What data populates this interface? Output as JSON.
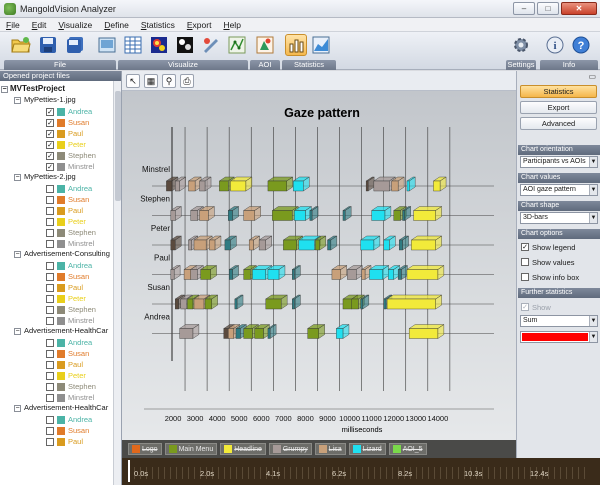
{
  "window": {
    "title": "MangoldVision Analyzer",
    "minimize": "–",
    "maximize": "□",
    "close": "✕"
  },
  "menu": [
    "File",
    "Edit",
    "Visualize",
    "Define",
    "Statistics",
    "Export",
    "Help"
  ],
  "toolbar": {
    "groups": [
      {
        "caption": "File",
        "icons": [
          "open-folder-icon",
          "save-icon",
          "save-all-icon",
          "screenshot-icon"
        ]
      },
      {
        "caption": "Visualize",
        "icons": [
          "table-icon",
          "heatmap-icon",
          "spotlight-icon",
          "gaze-replay-icon",
          "scanpath-icon"
        ]
      },
      {
        "caption": "AOI",
        "icons": [
          "aoi-icon"
        ]
      },
      {
        "caption": "Statistics",
        "icons": [
          "statistics-bars-icon",
          "statistics-area-icon"
        ]
      },
      {
        "caption": "Settings",
        "icons": [
          "settings-icon"
        ]
      },
      {
        "caption": "Info",
        "icons": [
          "info-icon",
          "help-icon"
        ]
      }
    ]
  },
  "left_panel": {
    "header": "Opened project files",
    "root": "MVTestProject",
    "files": [
      {
        "name": "MyPetties-1.jpg",
        "participants": [
          {
            "name": "Andrea",
            "checked": true
          },
          {
            "name": "Susan",
            "checked": true
          },
          {
            "name": "Paul",
            "checked": true
          },
          {
            "name": "Peter",
            "checked": true
          },
          {
            "name": "Stephen",
            "checked": true
          },
          {
            "name": "Minstrel",
            "checked": true
          }
        ]
      },
      {
        "name": "MyPetties-2.jpg",
        "participants": [
          {
            "name": "Andrea",
            "checked": false
          },
          {
            "name": "Susan",
            "checked": false
          },
          {
            "name": "Paul",
            "checked": false
          },
          {
            "name": "Peter",
            "checked": false
          },
          {
            "name": "Stephen",
            "checked": false
          },
          {
            "name": "Minstrel",
            "checked": false
          }
        ]
      },
      {
        "name": "Advertisement-Consulting",
        "participants": [
          {
            "name": "Andrea",
            "checked": false
          },
          {
            "name": "Susan",
            "checked": false
          },
          {
            "name": "Paul",
            "checked": false
          },
          {
            "name": "Peter",
            "checked": false
          },
          {
            "name": "Stephen",
            "checked": false
          },
          {
            "name": "Minstrel",
            "checked": false
          }
        ]
      },
      {
        "name": "Advertisement-HealthCar",
        "participants": [
          {
            "name": "Andrea",
            "checked": false
          },
          {
            "name": "Susan",
            "checked": false
          },
          {
            "name": "Paul",
            "checked": false
          },
          {
            "name": "Peter",
            "checked": false
          },
          {
            "name": "Stephen",
            "checked": false
          },
          {
            "name": "Minstrel",
            "checked": false
          }
        ]
      },
      {
        "name": "Advertisement-HealthCar",
        "participants": [
          {
            "name": "Andrea",
            "checked": false
          },
          {
            "name": "Susan",
            "checked": false
          },
          {
            "name": "Paul",
            "checked": false
          }
        ]
      }
    ],
    "participant_colors": {
      "Andrea": "#4bb3a6",
      "Susan": "#e07b2a",
      "Paul": "#d99b1e",
      "Peter": "#e9cf1a",
      "Stephen": "#8d8a78",
      "Minstrel": "#8f8f8f"
    }
  },
  "chart_toolbar": {
    "icons": [
      "pointer-icon",
      "copy-chart-icon",
      "zoom-icon",
      "print-icon"
    ]
  },
  "chart_data": {
    "type": "bar",
    "subtype": "3D gantt / gaze timeline",
    "title": "Gaze pattern",
    "xlabel": "milliseconds",
    "xlim": [
      1500,
      16000
    ],
    "xticks": [
      2000,
      3000,
      4000,
      5000,
      6000,
      7000,
      8000,
      9000,
      10000,
      11000,
      12000,
      13000,
      14000
    ],
    "categories": [
      "Minstrel",
      "Stephen",
      "Peter",
      "Paul",
      "Susan",
      "Andrea"
    ],
    "aoi_colors": {
      "Logo": "#5a4a3e",
      "Main Menu": "#7a9a1e",
      "Headline": "#f2ea3a",
      "Grumpy": "#a69a98",
      "Lisa": "#c8a07a",
      "Lizard": "#1fe0f0",
      "AOI_5": "#2f7b82"
    },
    "series": [
      {
        "name": "Minstrel",
        "segments": [
          [
            1700,
            1950,
            "Logo"
          ],
          [
            2100,
            2300,
            "Grumpy"
          ],
          [
            2700,
            3000,
            "Lisa"
          ],
          [
            3200,
            3450,
            "Grumpy"
          ],
          [
            4100,
            4500,
            "Main Menu"
          ],
          [
            4600,
            5300,
            "Headline"
          ],
          [
            6300,
            7150,
            "Main Menu"
          ],
          [
            7450,
            7900,
            "Lizard"
          ],
          [
            10750,
            10800,
            "Logo"
          ],
          [
            11100,
            11800,
            "Grumpy"
          ],
          [
            11900,
            12200,
            "Lisa"
          ],
          [
            12600,
            12700,
            "Lizard"
          ],
          [
            13800,
            14100,
            "Headline"
          ]
        ]
      },
      {
        "name": "Stephen",
        "segments": [
          [
            1900,
            2100,
            "Grumpy"
          ],
          [
            2800,
            3100,
            "Grumpy"
          ],
          [
            3200,
            3600,
            "Lisa"
          ],
          [
            4500,
            4700,
            "AOI_5"
          ],
          [
            5200,
            5700,
            "Lisa"
          ],
          [
            6500,
            7400,
            "Main Menu"
          ],
          [
            7500,
            8000,
            "Lizard"
          ],
          [
            8200,
            8300,
            "AOI_5"
          ],
          [
            9700,
            9800,
            "AOI_5"
          ],
          [
            11000,
            11600,
            "Lizard"
          ],
          [
            12000,
            12300,
            "Main Menu"
          ],
          [
            12400,
            12500,
            "AOI_5"
          ],
          [
            12900,
            13900,
            "Headline"
          ]
        ]
      },
      {
        "name": "Peter",
        "segments": [
          [
            1900,
            2100,
            "Logo"
          ],
          [
            2700,
            2850,
            "Grumpy"
          ],
          [
            2950,
            3500,
            "Lisa"
          ],
          [
            3650,
            3900,
            "Lisa"
          ],
          [
            4350,
            4600,
            "AOI_5"
          ],
          [
            5450,
            5650,
            "Lisa"
          ],
          [
            5900,
            6200,
            "Grumpy"
          ],
          [
            7000,
            7600,
            "Main Menu"
          ],
          [
            7700,
            8400,
            "Lizard"
          ],
          [
            8450,
            8650,
            "Main Menu"
          ],
          [
            9000,
            9150,
            "AOI_5"
          ],
          [
            10500,
            11100,
            "Lizard"
          ],
          [
            11550,
            11800,
            "Lizard"
          ],
          [
            12250,
            12400,
            "AOI_5"
          ],
          [
            12800,
            13900,
            "Headline"
          ]
        ]
      },
      {
        "name": "Paul",
        "segments": [
          [
            1900,
            2050,
            "Grumpy"
          ],
          [
            2500,
            2800,
            "Lisa"
          ],
          [
            2800,
            3100,
            "Grumpy"
          ],
          [
            3250,
            3700,
            "Main Menu"
          ],
          [
            4550,
            4700,
            "AOI_5"
          ],
          [
            5200,
            5500,
            "Main Menu"
          ],
          [
            5600,
            6200,
            "Lizard"
          ],
          [
            6300,
            6800,
            "Lizard"
          ],
          [
            7400,
            7500,
            "AOI_5"
          ],
          [
            9200,
            9600,
            "Lisa"
          ],
          [
            9900,
            10300,
            "Grumpy"
          ],
          [
            10550,
            10700,
            "Lisa"
          ],
          [
            10900,
            11500,
            "Lizard"
          ],
          [
            11750,
            12000,
            "Lizard"
          ],
          [
            12200,
            12350,
            "AOI_5"
          ],
          [
            12600,
            14000,
            "Headline"
          ]
        ]
      },
      {
        "name": "Susan",
        "segments": [
          [
            2100,
            2250,
            "Logo"
          ],
          [
            2350,
            2600,
            "Grumpy"
          ],
          [
            2650,
            2900,
            "Main Menu"
          ],
          [
            2950,
            3400,
            "Lisa"
          ],
          [
            3450,
            3750,
            "Main Menu"
          ],
          [
            4800,
            4900,
            "AOI_5"
          ],
          [
            6200,
            6900,
            "Main Menu"
          ],
          [
            7400,
            7500,
            "AOI_5"
          ],
          [
            9700,
            10100,
            "Main Menu"
          ],
          [
            10100,
            10400,
            "Main Menu"
          ],
          [
            10500,
            10600,
            "AOI_5"
          ],
          [
            11550,
            11650,
            "AOI_5"
          ],
          [
            11700,
            13900,
            "Headline"
          ]
        ]
      },
      {
        "name": "Andrea",
        "segments": [
          [
            2300,
            2900,
            "Grumpy"
          ],
          [
            4300,
            4500,
            "Logo"
          ],
          [
            4500,
            4750,
            "Lisa"
          ],
          [
            4850,
            5050,
            "AOI_5"
          ],
          [
            5200,
            5600,
            "Main Menu"
          ],
          [
            5700,
            6100,
            "Main Menu"
          ],
          [
            6300,
            6400,
            "AOI_5"
          ],
          [
            8100,
            8600,
            "Main Menu"
          ],
          [
            9400,
            9700,
            "Lizard"
          ],
          [
            12700,
            14000,
            "Headline"
          ]
        ]
      }
    ]
  },
  "legend": [
    {
      "label": "Logo",
      "color": "#e0681c"
    },
    {
      "label": "Main Menu",
      "color": "#7a9a1e"
    },
    {
      "label": "Headline",
      "color": "#f2ea3a"
    },
    {
      "label": "Grumpy",
      "color": "#a69a98"
    },
    {
      "label": "Lisa",
      "color": "#c8a07a"
    },
    {
      "label": "Lizard",
      "color": "#1fe0f0"
    },
    {
      "label": "AOI_5",
      "color": "#7ad84a"
    }
  ],
  "timeline": {
    "labels": [
      "0.0s",
      "2.0s",
      "4.1s",
      "6.2s",
      "8.2s",
      "10.3s",
      "12.4s"
    ]
  },
  "right_panel": {
    "tabs": [
      {
        "label": "Statistics",
        "active": true
      },
      {
        "label": "Export",
        "active": false
      },
      {
        "label": "Advanced",
        "active": false
      }
    ],
    "chart_orientation": {
      "header": "Chart orientation",
      "value": "Participants vs AOIs"
    },
    "chart_values": {
      "header": "Chart values",
      "value": "AOI gaze pattern"
    },
    "chart_shape": {
      "header": "Chart shape",
      "value": "3D-bars"
    },
    "chart_options": {
      "header": "Chart options",
      "show_legend": "Show legend",
      "show_values": "Show values",
      "show_info_box": "Show info box"
    },
    "further_statistics": {
      "header": "Further statistics",
      "show": "Show",
      "aggregate": "Sum",
      "color": "#ff0000"
    }
  }
}
